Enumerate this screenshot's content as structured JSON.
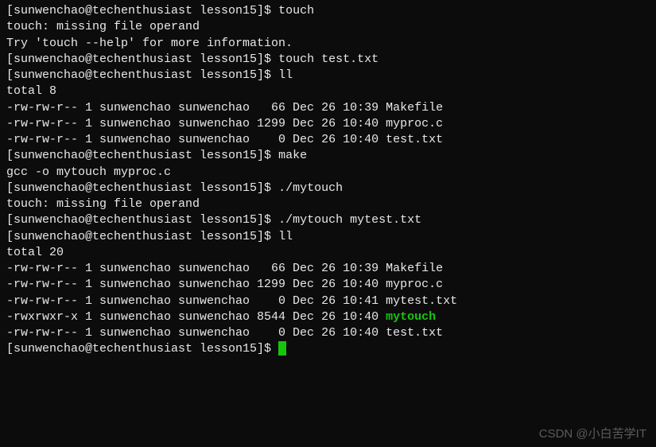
{
  "prompt": "[sunwenchao@techenthusiast lesson15]$ ",
  "lines": [
    {
      "type": "prompt",
      "cmd": "touch"
    },
    {
      "type": "out",
      "text": "touch: missing file operand"
    },
    {
      "type": "out",
      "text": "Try 'touch --help' for more information."
    },
    {
      "type": "prompt",
      "cmd": "touch test.txt"
    },
    {
      "type": "prompt",
      "cmd": "ll"
    },
    {
      "type": "out",
      "text": "total 8"
    },
    {
      "type": "ls",
      "perm": "-rw-rw-r--",
      "links": "1",
      "owner": "sunwenchao",
      "group": "sunwenchao",
      "size": "  66",
      "date": "Dec 26 10:39",
      "name": "Makefile",
      "exec": false
    },
    {
      "type": "ls",
      "perm": "-rw-rw-r--",
      "links": "1",
      "owner": "sunwenchao",
      "group": "sunwenchao",
      "size": "1299",
      "date": "Dec 26 10:40",
      "name": "myproc.c",
      "exec": false
    },
    {
      "type": "ls",
      "perm": "-rw-rw-r--",
      "links": "1",
      "owner": "sunwenchao",
      "group": "sunwenchao",
      "size": "   0",
      "date": "Dec 26 10:40",
      "name": "test.txt",
      "exec": false
    },
    {
      "type": "prompt",
      "cmd": "make"
    },
    {
      "type": "out",
      "text": "gcc -o mytouch myproc.c"
    },
    {
      "type": "prompt",
      "cmd": "./mytouch"
    },
    {
      "type": "out",
      "text": "touch: missing file operand"
    },
    {
      "type": "prompt",
      "cmd": "./mytouch mytest.txt"
    },
    {
      "type": "prompt",
      "cmd": "ll"
    },
    {
      "type": "out",
      "text": "total 20"
    },
    {
      "type": "ls",
      "perm": "-rw-rw-r--",
      "links": "1",
      "owner": "sunwenchao",
      "group": "sunwenchao",
      "size": "  66",
      "date": "Dec 26 10:39",
      "name": "Makefile",
      "exec": false
    },
    {
      "type": "ls",
      "perm": "-rw-rw-r--",
      "links": "1",
      "owner": "sunwenchao",
      "group": "sunwenchao",
      "size": "1299",
      "date": "Dec 26 10:40",
      "name": "myproc.c",
      "exec": false
    },
    {
      "type": "ls",
      "perm": "-rw-rw-r--",
      "links": "1",
      "owner": "sunwenchao",
      "group": "sunwenchao",
      "size": "   0",
      "date": "Dec 26 10:41",
      "name": "mytest.txt",
      "exec": false
    },
    {
      "type": "ls",
      "perm": "-rwxrwxr-x",
      "links": "1",
      "owner": "sunwenchao",
      "group": "sunwenchao",
      "size": "8544",
      "date": "Dec 26 10:40",
      "name": "mytouch",
      "exec": true
    },
    {
      "type": "ls",
      "perm": "-rw-rw-r--",
      "links": "1",
      "owner": "sunwenchao",
      "group": "sunwenchao",
      "size": "   0",
      "date": "Dec 26 10:40",
      "name": "test.txt",
      "exec": false
    },
    {
      "type": "prompt-cursor",
      "cmd": ""
    }
  ],
  "watermark": "CSDN @小白苦学IT"
}
